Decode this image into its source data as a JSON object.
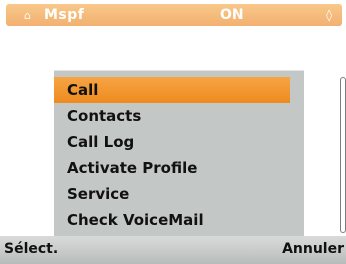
{
  "status_bar": {
    "icon": "profile-icon",
    "label": "Mspf",
    "value": "ON",
    "right_icon": "indicator-icon"
  },
  "menu": {
    "items": [
      {
        "label": "Call",
        "selected": true
      },
      {
        "label": "Contacts",
        "selected": false
      },
      {
        "label": "Call Log",
        "selected": false
      },
      {
        "label": "Activate Profile",
        "selected": false
      },
      {
        "label": "Service",
        "selected": false
      },
      {
        "label": "Check VoiceMail",
        "selected": false
      }
    ]
  },
  "softkeys": {
    "left": "Sélect.",
    "right": "Annuler"
  },
  "colors": {
    "highlight": "#f29a2e",
    "status_bar": "#f3b676",
    "panel": "#c3c7c5"
  }
}
